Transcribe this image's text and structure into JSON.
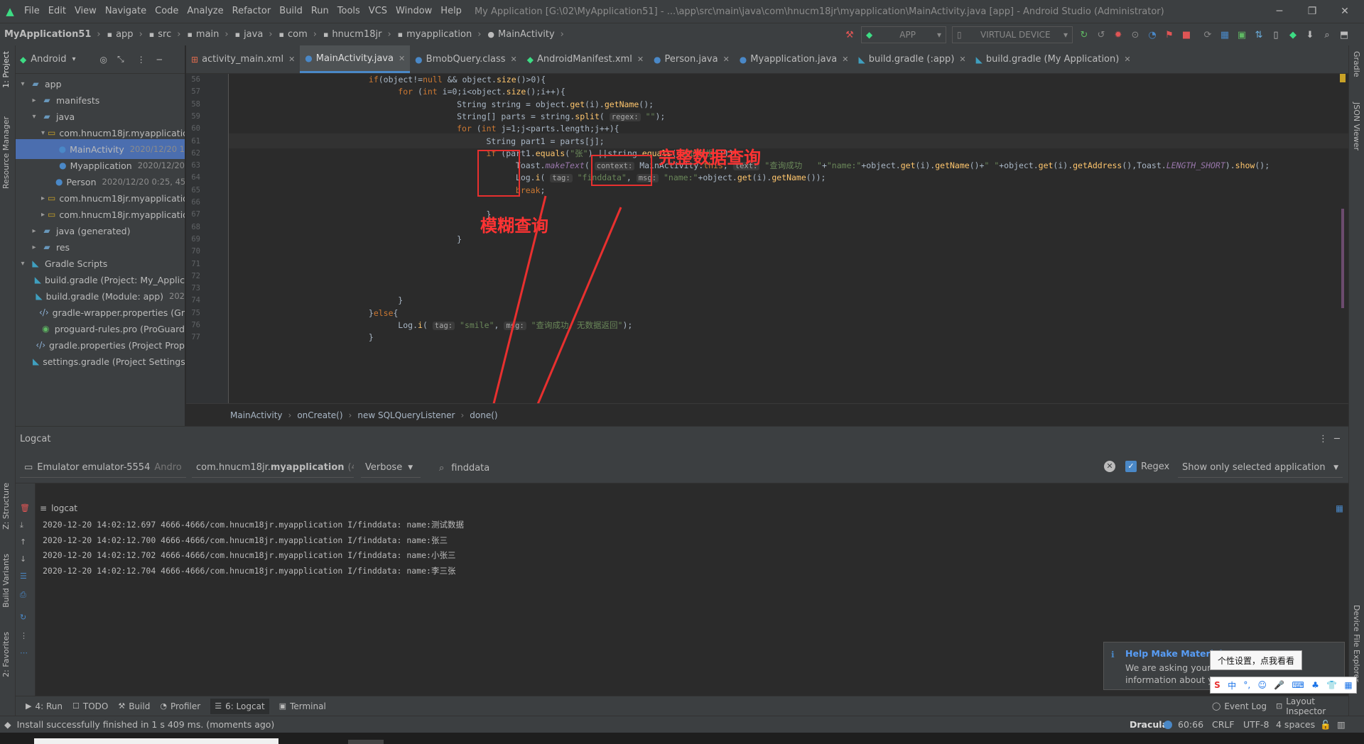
{
  "menubar": {
    "items": [
      "File",
      "Edit",
      "View",
      "Navigate",
      "Code",
      "Analyze",
      "Refactor",
      "Build",
      "Run",
      "Tools",
      "VCS",
      "Window",
      "Help"
    ],
    "window_title": "My Application [G:\\02\\MyApplication51] - ...\\app\\src\\main\\java\\com\\hnucm18jr\\myapplication\\MainActivity.java [app] - Android Studio (Administrator)"
  },
  "navbar": {
    "crumbs": [
      "MyApplication51",
      "app",
      "src",
      "main",
      "java",
      "com",
      "hnucm18jr",
      "myapplication",
      "MainActivity"
    ],
    "run_config": "APP",
    "device": "VIRTUAL DEVICE"
  },
  "left_strip": {
    "project": "1: Project",
    "resource_manager": "Resource Manager",
    "structure": "Z: Structure",
    "build_variants": "Build Variants",
    "favorites": "2: Favorites"
  },
  "right_strip": {
    "gradle": "Gradle",
    "json_viewer": "JSON Viewer",
    "device_explorer": "Device File Explorer"
  },
  "project_panel": {
    "view_mode": "Android",
    "tree": [
      {
        "label": "app",
        "meta": "",
        "indent": 0,
        "icon": "folder-icon",
        "toggle": "▾"
      },
      {
        "label": "manifests",
        "meta": "",
        "indent": 1,
        "icon": "folder-icon",
        "toggle": "▸"
      },
      {
        "label": "java",
        "meta": "",
        "indent": 1,
        "icon": "folder-icon",
        "toggle": "▾"
      },
      {
        "label": "com.hnucm18jr.myapplication",
        "meta": "",
        "indent": 2,
        "icon": "package-icon",
        "toggle": "▾"
      },
      {
        "label": "MainActivity",
        "meta": "2020/12/20 1",
        "indent": 3,
        "icon": "class-icon",
        "toggle": "",
        "selected": true
      },
      {
        "label": "Myapplication",
        "meta": "2020/12/20",
        "indent": 3,
        "icon": "class-icon",
        "toggle": ""
      },
      {
        "label": "Person",
        "meta": "2020/12/20 0:25, 45",
        "indent": 3,
        "icon": "class-icon",
        "toggle": ""
      },
      {
        "label": "com.hnucm18jr.myapplication",
        "meta": "",
        "indent": 2,
        "icon": "package-icon",
        "toggle": "▸"
      },
      {
        "label": "com.hnucm18jr.myapplication",
        "meta": "",
        "indent": 2,
        "icon": "package-icon",
        "toggle": "▸"
      },
      {
        "label": "java (generated)",
        "meta": "",
        "indent": 1,
        "icon": "folder-icon",
        "toggle": "▸"
      },
      {
        "label": "res",
        "meta": "",
        "indent": 1,
        "icon": "folder-icon",
        "toggle": "▸"
      },
      {
        "label": "Gradle Scripts",
        "meta": "",
        "indent": 0,
        "icon": "gradle-icon",
        "toggle": "▾"
      },
      {
        "label": "build.gradle (Project: My_Applic",
        "meta": "",
        "indent": 1,
        "icon": "gradle-icon",
        "toggle": ""
      },
      {
        "label": "build.gradle (Module: app)",
        "meta": "202",
        "indent": 1,
        "icon": "gradle-icon",
        "toggle": ""
      },
      {
        "label": "gradle-wrapper.properties (Gr",
        "meta": "",
        "indent": 1,
        "icon": "properties-icon",
        "toggle": ""
      },
      {
        "label": "proguard-rules.pro (ProGuard",
        "meta": "",
        "indent": 1,
        "icon": "proguard-icon",
        "toggle": ""
      },
      {
        "label": "gradle.properties (Project Prop",
        "meta": "",
        "indent": 1,
        "icon": "properties-icon",
        "toggle": ""
      },
      {
        "label": "settings.gradle (Project Settings",
        "meta": "",
        "indent": 1,
        "icon": "gradle-icon",
        "toggle": ""
      }
    ]
  },
  "tabs": [
    {
      "label": "activity_main.xml",
      "icon": "xml-icon",
      "active": false
    },
    {
      "label": "MainActivity.java",
      "icon": "class-icon",
      "active": true
    },
    {
      "label": "BmobQuery.class",
      "icon": "class-icon",
      "active": false
    },
    {
      "label": "AndroidManifest.xml",
      "icon": "android-icon",
      "active": false
    },
    {
      "label": "Person.java",
      "icon": "class-icon",
      "active": false
    },
    {
      "label": "Myapplication.java",
      "icon": "class-icon",
      "active": false
    },
    {
      "label": "build.gradle (:app)",
      "icon": "gradle-icon",
      "active": false
    },
    {
      "label": "build.gradle (My Application)",
      "icon": "gradle-icon",
      "active": false
    }
  ],
  "editor": {
    "line_numbers": [
      "56",
      "57",
      "58",
      "59",
      "60",
      "61",
      "62",
      "63",
      "64",
      "65",
      "66",
      "67",
      "68",
      "69",
      "70",
      "71",
      "72",
      "73",
      "74",
      "75",
      "76",
      "77"
    ],
    "lines": [
      {
        "indent": 7,
        "segs": [
          [
            "kw",
            "if"
          ],
          [
            "",
            "(object!="
          ],
          [
            "kw",
            "null"
          ],
          [
            "",
            " && object."
          ],
          [
            "fn",
            "size"
          ],
          [
            "",
            "()>0){"
          ]
        ]
      },
      {
        "indent": 9,
        "segs": [
          [
            "kw",
            "for"
          ],
          [
            "",
            " ("
          ],
          [
            "kw",
            "int"
          ],
          [
            "",
            " i=0;i<object."
          ],
          [
            "fn",
            "size"
          ],
          [
            "",
            "();i++){"
          ]
        ]
      },
      {
        "indent": 13,
        "segs": [
          [
            "",
            "String string = object."
          ],
          [
            "fn",
            "get"
          ],
          [
            "",
            "(i)."
          ],
          [
            "fn",
            "getName"
          ],
          [
            "",
            "();"
          ]
        ]
      },
      {
        "indent": 13,
        "segs": [
          [
            "",
            "String[] parts = string."
          ],
          [
            "fn",
            "split"
          ],
          [
            "",
            "( "
          ],
          [
            "hint",
            "regex:"
          ],
          [
            "",
            " "
          ],
          [
            "str",
            "\"\""
          ],
          [
            "",
            ");"
          ]
        ]
      },
      {
        "indent": 13,
        "segs": [
          [
            "kw",
            "for"
          ],
          [
            "",
            " ("
          ],
          [
            "kw",
            "int"
          ],
          [
            "",
            " j=1;j<parts.length;j++){"
          ]
        ]
      },
      {
        "indent": 15,
        "segs": [
          [
            "",
            "String part1 = parts[j];"
          ]
        ]
      },
      {
        "indent": 15,
        "segs": [
          [
            "kw",
            "if"
          ],
          [
            "",
            " (part1."
          ],
          [
            "fn",
            "equals"
          ],
          [
            "",
            "("
          ],
          [
            "str",
            "\"张\""
          ],
          [
            "",
            ") ||string."
          ],
          [
            "fn",
            "equals"
          ],
          [
            "",
            "("
          ],
          [
            "str",
            "\"测试数据\""
          ],
          [
            "",
            "))}"
          ]
        ]
      },
      {
        "indent": 17,
        "segs": [
          [
            "",
            "Toast."
          ],
          [
            "ital",
            "makeText"
          ],
          [
            "",
            "( "
          ],
          [
            "hint",
            "context:"
          ],
          [
            "",
            " MainActivity."
          ],
          [
            "kw",
            "this"
          ],
          [
            "",
            ", "
          ],
          [
            "hint",
            "text:"
          ],
          [
            "",
            " "
          ],
          [
            "str",
            "\"查询成功   \""
          ],
          [
            "",
            "+"
          ],
          [
            "str",
            "\"name:\""
          ],
          [
            "",
            "+object."
          ],
          [
            "fn",
            "get"
          ],
          [
            "",
            "(i)."
          ],
          [
            "fn",
            "getName"
          ],
          [
            "",
            "()+"
          ],
          [
            "str",
            "\" \""
          ],
          [
            "",
            "+object."
          ],
          [
            "fn",
            "get"
          ],
          [
            "",
            "(i)."
          ],
          [
            "fn",
            "getAddress"
          ],
          [
            "",
            "(),Toast."
          ],
          [
            "ital",
            "LENGTH_SHORT"
          ],
          [
            "",
            ")."
          ],
          [
            "fn",
            "show"
          ],
          [
            "",
            "();"
          ]
        ]
      },
      {
        "indent": 17,
        "segs": [
          [
            "",
            "Log."
          ],
          [
            "fn",
            "i"
          ],
          [
            "",
            "( "
          ],
          [
            "hint",
            "tag:"
          ],
          [
            "",
            " "
          ],
          [
            "str",
            "\"finddata\""
          ],
          [
            "",
            ", "
          ],
          [
            "hint",
            "msg:"
          ],
          [
            "",
            " "
          ],
          [
            "str",
            "\"name:\""
          ],
          [
            "",
            "+object."
          ],
          [
            "fn",
            "get"
          ],
          [
            "",
            "(i)."
          ],
          [
            "fn",
            "getName"
          ],
          [
            "",
            "());"
          ]
        ]
      },
      {
        "indent": 17,
        "segs": [
          [
            "kw",
            "break"
          ],
          [
            "",
            ";"
          ]
        ]
      },
      {
        "indent": 0,
        "segs": [
          [
            "",
            ""
          ]
        ]
      },
      {
        "indent": 15,
        "segs": [
          [
            "",
            "}"
          ]
        ]
      },
      {
        "indent": 0,
        "segs": [
          [
            "",
            ""
          ]
        ]
      },
      {
        "indent": 13,
        "segs": [
          [
            "",
            "}"
          ]
        ]
      },
      {
        "indent": 0,
        "segs": [
          [
            "",
            ""
          ]
        ]
      },
      {
        "indent": 0,
        "segs": [
          [
            "",
            ""
          ]
        ]
      },
      {
        "indent": 0,
        "segs": [
          [
            "",
            ""
          ]
        ]
      },
      {
        "indent": 0,
        "segs": [
          [
            "",
            ""
          ]
        ]
      },
      {
        "indent": 9,
        "segs": [
          [
            "",
            "}"
          ]
        ]
      },
      {
        "indent": 7,
        "segs": [
          [
            "",
            "}"
          ],
          [
            "kw",
            "else"
          ],
          [
            "",
            "{"
          ]
        ]
      },
      {
        "indent": 9,
        "segs": [
          [
            "",
            "Log."
          ],
          [
            "fn",
            "i"
          ],
          [
            "",
            "( "
          ],
          [
            "hint",
            "tag:"
          ],
          [
            "",
            " "
          ],
          [
            "str",
            "\"smile\""
          ],
          [
            "",
            ", "
          ],
          [
            "hint",
            "msg:"
          ],
          [
            "",
            " "
          ],
          [
            "str",
            "\"查询成功，无数据返回\""
          ],
          [
            "",
            ");"
          ]
        ]
      },
      {
        "indent": 7,
        "segs": [
          [
            "",
            "}"
          ]
        ]
      }
    ]
  },
  "annotations": {
    "exact_query": "完整数据查询",
    "fuzzy_query": "模糊查询"
  },
  "code_breadcrumb": [
    "MainActivity",
    "onCreate()",
    "new SQLQueryListener",
    "done()"
  ],
  "logcat": {
    "title": "Logcat",
    "device": "Emulator emulator-5554",
    "device_suffix": "Andro",
    "process_prefix": "com.hnucm18jr.",
    "process_bold": "myapplication",
    "process_suffix": "(46",
    "level": "Verbose",
    "search": "finddata",
    "regex_label": "Regex",
    "regex_checked": true,
    "filter_mode": "Show only selected application",
    "tab_label": "logcat",
    "lines": [
      "2020-12-20 14:02:12.697 4666-4666/com.hnucm18jr.myapplication I/finddata: name:测试数据",
      "2020-12-20 14:02:12.700 4666-4666/com.hnucm18jr.myapplication I/finddata: name:张三",
      "2020-12-20 14:02:12.702 4666-4666/com.hnucm18jr.myapplication I/finddata: name:小张三",
      "2020-12-20 14:02:12.704 4666-4666/com.hnucm18jr.myapplication I/finddata: name:李三张"
    ]
  },
  "bottom_tools": [
    {
      "label": "4: Run",
      "icon": "run-icon"
    },
    {
      "label": "TODO",
      "icon": "todo-icon"
    },
    {
      "label": "Build",
      "icon": "build-icon"
    },
    {
      "label": "Profiler",
      "icon": "profiler-icon"
    },
    {
      "label": "6: Logcat",
      "icon": "logcat-icon",
      "active": true
    },
    {
      "label": "Terminal",
      "icon": "terminal-icon"
    }
  ],
  "bottom_right_tools": {
    "event_log": "Event Log",
    "layout_inspector": "Layout Inspector"
  },
  "notification": {
    "title": "Help Make Material",
    "body_line1": "We are asking your",
    "body_line2": "information about yo"
  },
  "tooltip": "个性设置，点我看看",
  "status": {
    "message": "Install successfully finished in 1 s 409 ms. (moments ago)",
    "theme": "Dracula",
    "position": "60:66",
    "line_sep": "CRLF",
    "encoding": "UTF-8",
    "indent": "4 spaces"
  },
  "colors": {
    "accent": "#4a88c7",
    "annotation": "#ff3333",
    "selection": "#4b6eaf"
  }
}
